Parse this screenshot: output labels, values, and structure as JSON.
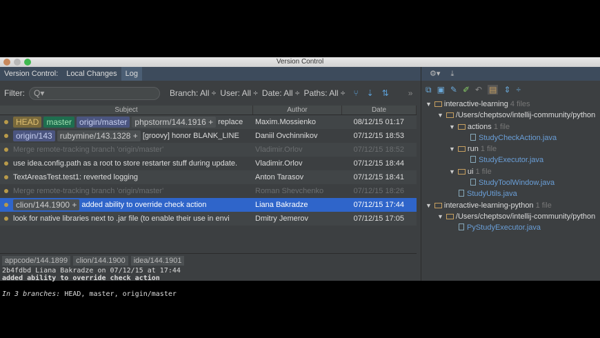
{
  "window": {
    "title": "Version Control"
  },
  "tabs": {
    "prefix": "Version Control:",
    "items": [
      "Local Changes",
      "Log"
    ],
    "active": "Log"
  },
  "filter": {
    "label": "Filter:",
    "search_placeholder": "Q▾",
    "branch": "Branch: All ÷",
    "user": "User: All ÷",
    "date": "Date: All ÷",
    "paths": "Paths: All ÷",
    "more": "»"
  },
  "columns": {
    "subject": "Subject",
    "author": "Author",
    "date": "Date"
  },
  "commits": [
    {
      "tags": [
        {
          "t": "HEAD",
          "c": "t-head"
        },
        {
          "t": "master",
          "c": "t-master"
        },
        {
          "t": "origin/master",
          "c": "t-orig"
        },
        {
          "t": "phpstorm/144.1916 +",
          "c": "t-gray"
        }
      ],
      "subject": "replace",
      "author": "Maxim.Mossienko",
      "date": "08/12/15 01:17",
      "style": "alt"
    },
    {
      "tags": [
        {
          "t": "origin/143",
          "c": "t-orig"
        },
        {
          "t": "rubymine/143.1328 +",
          "c": "t-gray"
        }
      ],
      "subject": "[groovy] honor BLANK_LINE",
      "author": "Daniil Ovchinnikov",
      "date": "07/12/15 18:53",
      "style": ""
    },
    {
      "tags": [],
      "subject": "Merge remote-tracking branch 'origin/master'",
      "author": "Vladimir.Orlov",
      "date": "07/12/15 18:52",
      "style": "dim alt"
    },
    {
      "tags": [],
      "subject": "use idea.config.path as a root to store restarter stuff during update.",
      "author": "Vladimir.Orlov",
      "date": "07/12/15 18:44",
      "style": ""
    },
    {
      "tags": [],
      "subject": "TextAreasTest.test1: reverted logging",
      "author": "Anton Tarasov",
      "date": "07/12/15 18:41",
      "style": "alt"
    },
    {
      "tags": [],
      "subject": "Merge remote-tracking branch 'origin/master'",
      "author": "Roman Shevchenko",
      "date": "07/12/15 18:26",
      "style": "dim"
    },
    {
      "tags": [
        {
          "t": "clion/144.1900 +",
          "c": "t-gray"
        }
      ],
      "subject": "added ability to override check action",
      "author": "Liana Bakradze",
      "date": "07/12/15 17:44",
      "style": "sel"
    },
    {
      "tags": [],
      "subject": "look for native libraries next to .jar file (to enable their use in envi",
      "author": "Dmitry Jemerov",
      "date": "07/12/15 17:05",
      "style": "alt"
    }
  ],
  "details": {
    "branches": [
      "appcode/144.1899",
      "clion/144.1900",
      "idea/144.1901"
    ],
    "header": "2b4fdbd Liana Bakradze on 07/12/15 at 17:44",
    "message": "added ability to override check action",
    "in_label": "In 3 branches:",
    "in_list": "HEAD, master, origin/master"
  },
  "tree": [
    {
      "level": 0,
      "type": "module",
      "name": "interactive-learning",
      "count": "4 files"
    },
    {
      "level": 1,
      "type": "folder",
      "name": "/Users/cheptsov/intellij-community/python",
      "count": ""
    },
    {
      "level": 2,
      "type": "folder",
      "name": "actions",
      "count": "1 file"
    },
    {
      "level": 3,
      "type": "file",
      "name": "StudyCheckAction.java",
      "count": ""
    },
    {
      "level": 2,
      "type": "folder",
      "name": "run",
      "count": "1 file"
    },
    {
      "level": 3,
      "type": "file",
      "name": "StudyExecutor.java",
      "count": ""
    },
    {
      "level": 2,
      "type": "folder",
      "name": "ui",
      "count": "1 file"
    },
    {
      "level": 3,
      "type": "file",
      "name": "StudyToolWindow.java",
      "count": ""
    },
    {
      "level": 2,
      "type": "file",
      "name": "StudyUtils.java",
      "count": ""
    },
    {
      "level": 0,
      "type": "module",
      "name": "interactive-learning-python",
      "count": "1 file"
    },
    {
      "level": 1,
      "type": "folder",
      "name": "/Users/cheptsov/intellij-community/python",
      "count": ""
    },
    {
      "level": 2,
      "type": "file",
      "name": "PyStudyExecutor.java",
      "count": ""
    }
  ]
}
